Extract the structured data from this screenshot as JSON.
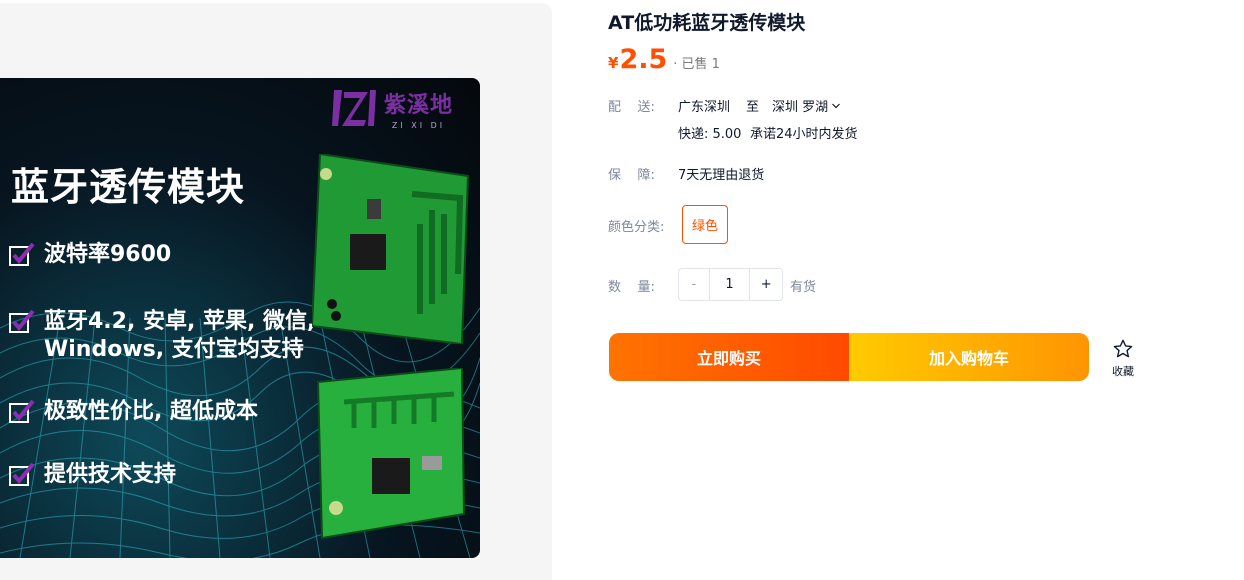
{
  "gallery": {
    "logo_text": "紫溪地",
    "logo_subtext": "ZI XI DI",
    "hero_title": "蓝牙透传模块",
    "features": [
      {
        "line1": "波特率9600",
        "line2": ""
      },
      {
        "line1": "蓝牙4.2, 安卓, 苹果, 微信,",
        "line2": "Windows, 支付宝均支持"
      },
      {
        "line1": "极致性价比, 超低成本",
        "line2": ""
      },
      {
        "line1": "提供技术支持",
        "line2": ""
      }
    ]
  },
  "product": {
    "title": "AT低功耗蓝牙透传模块",
    "currency": "¥",
    "price": "2.5",
    "sold": "· 已售 1"
  },
  "shipping": {
    "label": "配    送:",
    "from": "广东深圳",
    "to_word": "至",
    "to": "深圳 罗湖",
    "fee": "快递: 5.00",
    "promise": "承诺24小时内发货"
  },
  "guarantee": {
    "label": "保    障:",
    "value": "7天无理由退货"
  },
  "color": {
    "label": "颜色分类:",
    "options": [
      "绿色"
    ]
  },
  "quantity": {
    "label": "数    量:",
    "minus": "-",
    "value": "1",
    "plus": "+",
    "stock": "有货"
  },
  "actions": {
    "buy_now": "立即购买",
    "add_to_cart": "加入购物车",
    "favorite": "收藏"
  },
  "colors": {
    "accent": "#ff5000",
    "buy_start": "#ff7300",
    "buy_end": "#ff4a00",
    "cart_start": "#ffcb00",
    "cart_end": "#ff9402",
    "label_gray": "#7c889c",
    "logo_purple": "#7b2fa3"
  },
  "icons": {
    "check": "checkbox-check-icon",
    "star": "star-outline-icon",
    "chevron": "chevron-down-icon"
  }
}
